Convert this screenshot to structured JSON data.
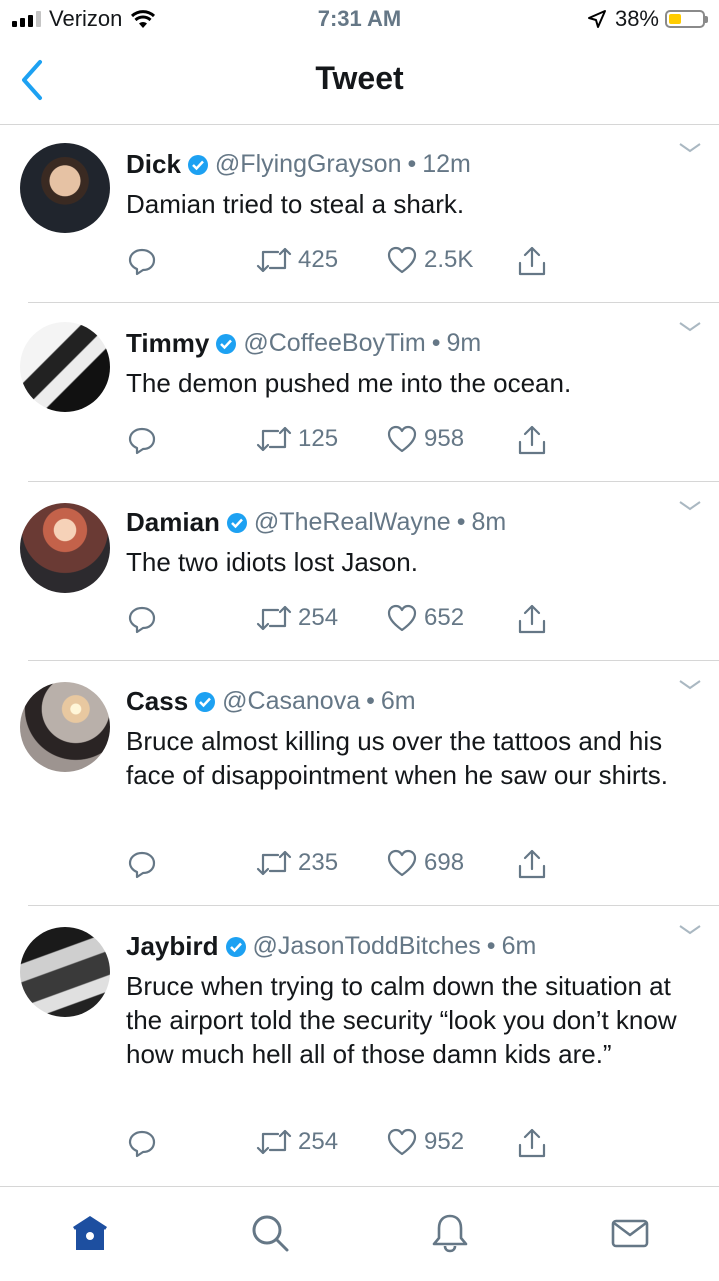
{
  "status_bar": {
    "carrier": "Verizon",
    "time": "7:31 AM",
    "battery": "38%",
    "battery_level": 0.38,
    "battery_color": "#ffcc00",
    "icons": [
      "signal-icon",
      "wifi-icon",
      "location-arrow-icon",
      "battery-icon"
    ]
  },
  "header": {
    "title": "Tweet",
    "back_icon": "chevron-left-icon"
  },
  "accent_color": "#1da1f2",
  "tweets": [
    {
      "name": "Dick",
      "handle": "@FlyingGrayson",
      "time": "12m",
      "text": "Damian tried to steal a shark.",
      "retweets": "425",
      "likes": "2.5K"
    },
    {
      "name": "Timmy",
      "handle": "@CoffeeBoyTim",
      "time": "9m",
      "text": "The demon pushed me into the ocean.",
      "retweets": "125",
      "likes": "958"
    },
    {
      "name": "Damian",
      "handle": "@TheRealWayne",
      "time": "8m",
      "text": "The two idiots lost Jason.",
      "retweets": "254",
      "likes": "652"
    },
    {
      "name": "Cass",
      "handle": "@Casanova",
      "time": "6m",
      "text": "Bruce almost killing us over the tattoos and his face of disappointment when he saw our shirts.",
      "retweets": "235",
      "likes": "698"
    },
    {
      "name": "Jaybird",
      "handle": "@JasonToddBitches",
      "time": "6m",
      "text": "Bruce when trying to calm down the situation at the airport told the security “look you don’t know how much hell all of those damn kids are.”",
      "retweets": "254",
      "likes": "952"
    }
  ],
  "dot_separator": "•",
  "tab_bar": {
    "icons": [
      "home-icon",
      "search-icon",
      "notifications-bell-icon",
      "messages-envelope-icon"
    ]
  }
}
